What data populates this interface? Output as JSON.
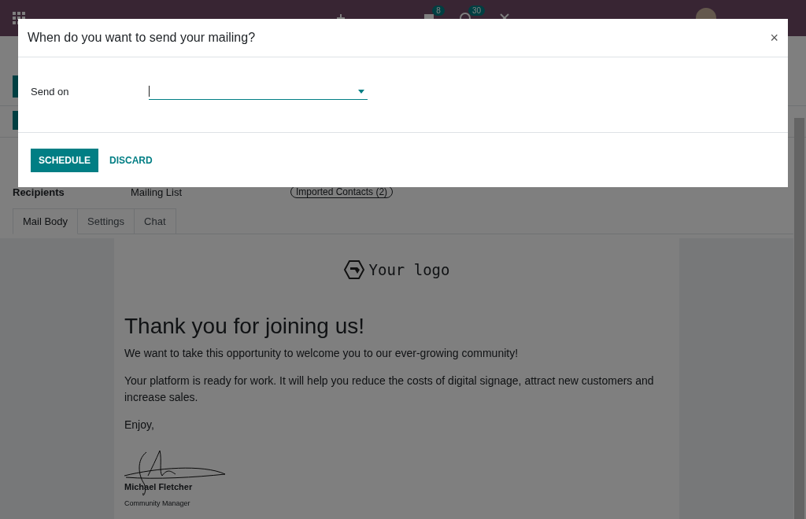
{
  "navbar": {
    "message_count": "8",
    "activity_count": "30"
  },
  "form": {
    "fields": [
      {
        "label": "Recipients",
        "value": "Mailing List",
        "tag": "Imported Contacts (2)"
      }
    ]
  },
  "tabs": [
    {
      "label": "Mail Body",
      "selected": true
    },
    {
      "label": "Settings",
      "selected": false
    },
    {
      "label": "Chat",
      "selected": false
    }
  ],
  "mail": {
    "logo_text": "Your logo",
    "heading": "Thank you for joining us!",
    "paragraphs": [
      "We want to take this opportunity to welcome you to our ever-growing community!",
      "Your platform is ready for work. It will help you reduce the costs of digital signage, attract new customers and increase sales.",
      "Enjoy,"
    ],
    "signer": "Michael Fletcher",
    "signer_role": "Community Manager"
  },
  "dialog": {
    "title": "When do you want to send your mailing?",
    "close": "×",
    "field_label": "Send on",
    "buttons": [
      {
        "label": "SCHEDULE",
        "kind": "primary"
      },
      {
        "label": "DISCARD",
        "kind": "link"
      }
    ]
  }
}
